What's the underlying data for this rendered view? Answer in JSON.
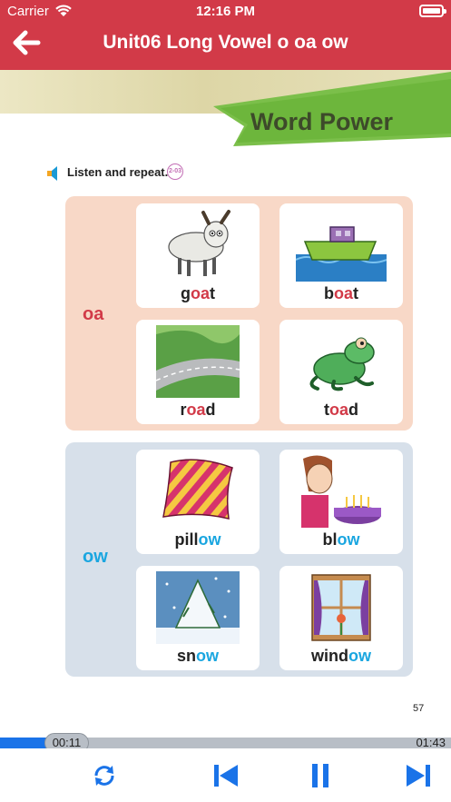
{
  "status": {
    "carrier": "Carrier",
    "time": "12:16 PM"
  },
  "nav": {
    "title": "Unit06 Long Vowel o oa ow"
  },
  "page": {
    "section": "Word Power",
    "instruction": "Listen and repeat.",
    "track": "2-03",
    "page_number": "57",
    "groups": [
      {
        "label": "oa",
        "words": [
          {
            "pre": "g",
            "hl": "oa",
            "post": "t",
            "image": "goat"
          },
          {
            "pre": "b",
            "hl": "oa",
            "post": "t",
            "image": "boat"
          },
          {
            "pre": "r",
            "hl": "oa",
            "post": "d",
            "image": "road"
          },
          {
            "pre": "t",
            "hl": "oa",
            "post": "d",
            "image": "toad"
          }
        ]
      },
      {
        "label": "ow",
        "words": [
          {
            "pre": "pill",
            "hl": "ow",
            "post": "",
            "image": "pillow"
          },
          {
            "pre": "bl",
            "hl": "ow",
            "post": "",
            "image": "blow"
          },
          {
            "pre": "sn",
            "hl": "ow",
            "post": "",
            "image": "snow"
          },
          {
            "pre": "wind",
            "hl": "ow",
            "post": "",
            "image": "window"
          }
        ]
      }
    ]
  },
  "player": {
    "elapsed": "00:11",
    "total": "01:43",
    "progress_fraction": 0.107,
    "controls": [
      "repeat-icon",
      "previous-icon",
      "pause-icon",
      "next-icon"
    ],
    "accent_color": "#1a73e8"
  },
  "colors": {
    "header": "#d23a48",
    "oa": "#d23a48",
    "ow": "#1aa6e0"
  }
}
